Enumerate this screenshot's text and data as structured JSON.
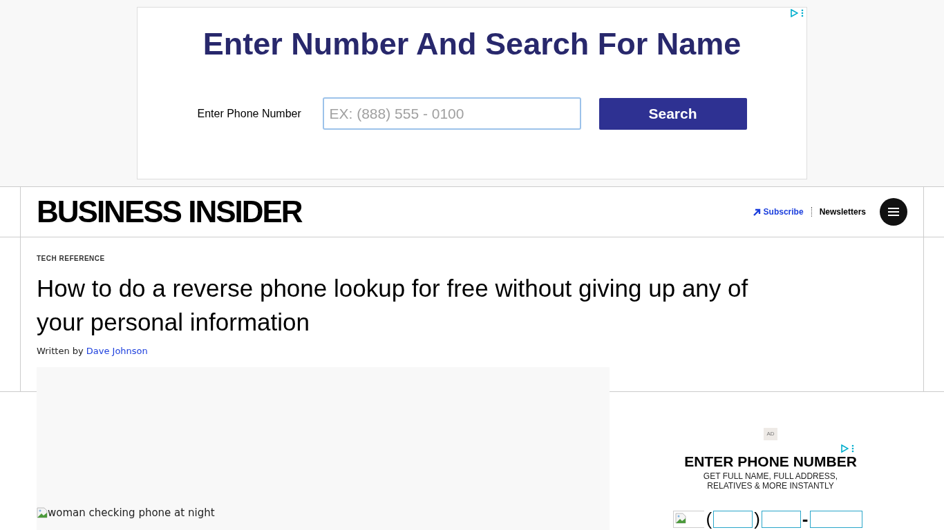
{
  "top_ad": {
    "title": "Enter Number And Search For Name",
    "label": "Enter Phone Number",
    "placeholder": "EX: (888) 555 - 0100",
    "button": "Search"
  },
  "header": {
    "logo": "BUSINESS INSIDER",
    "subscribe": "Subscribe",
    "newsletters": "Newsletters"
  },
  "article": {
    "category": "TECH REFERENCE",
    "title": "How to do a reverse phone lookup for free without giving up any of your personal information",
    "byline_prefix": "Written by",
    "author": "Dave Johnson",
    "image_alt": "woman checking phone at night"
  },
  "side_ad": {
    "badge": "AD",
    "title": "ENTER PHONE NUMBER",
    "subtitle_lines": [
      "GET FULL NAME, FULL ADDRESS,",
      "RELATIVES & MORE INSTANTLY"
    ],
    "open_paren": "(",
    "close_paren": ")",
    "dash": "-"
  }
}
